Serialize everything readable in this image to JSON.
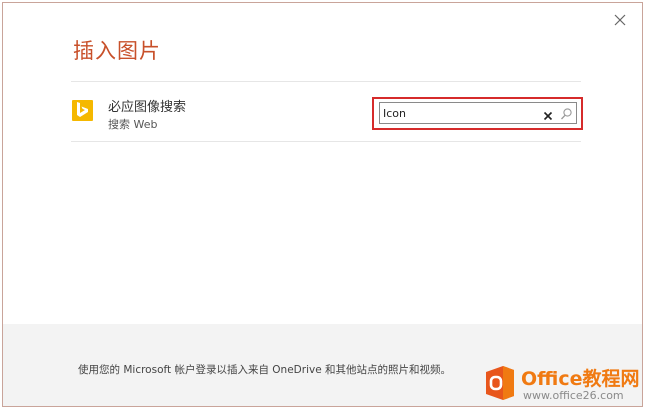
{
  "dialog": {
    "title": "插入图片",
    "close_icon": "close-icon"
  },
  "provider": {
    "icon": "bing-logo-icon",
    "name": "必应图像搜索",
    "subtitle": "搜索 Web",
    "search": {
      "value": "Icon",
      "clear_icon": "clear-icon",
      "search_icon": "search-icon"
    }
  },
  "footer": {
    "text": "使用您的 Microsoft 帐户登录以插入来自 OneDrive 和其他站点的照片和视频。"
  },
  "watermark": {
    "title": "Office教程网",
    "url": "www.office26.com"
  },
  "colors": {
    "title": "#c8502a",
    "highlight": "#d62b2b",
    "bing": "#f5b800",
    "watermark": "#f07a12"
  }
}
